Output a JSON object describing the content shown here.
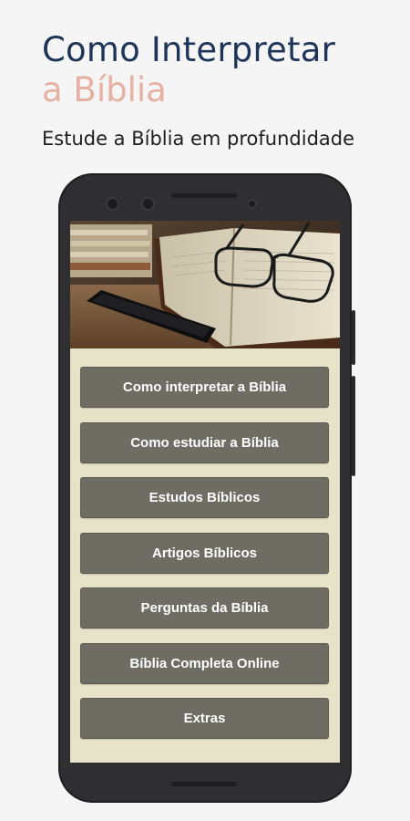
{
  "headline": {
    "line1": "Como Interpretar",
    "line2": "a Bíblia",
    "subtitle": "Estude a Bíblia em profundidade"
  },
  "app": {
    "hero_image": "book-glasses-phone-photo",
    "menu": [
      {
        "label": "Como interpretar a Bíblia"
      },
      {
        "label": "Como estudiar a Bíblia"
      },
      {
        "label": "Estudos Bíblicos"
      },
      {
        "label": "Artigos Bíblicos"
      },
      {
        "label": "Perguntas da Bíblia"
      },
      {
        "label": "Bíblia Completa Online"
      },
      {
        "label": "Extras"
      }
    ]
  },
  "colors": {
    "title": "#1e3557",
    "accent": "#e6b1a3",
    "button": "#6f6c63",
    "screen_bg": "#e7e3c9",
    "phone": "#2f2f31"
  }
}
